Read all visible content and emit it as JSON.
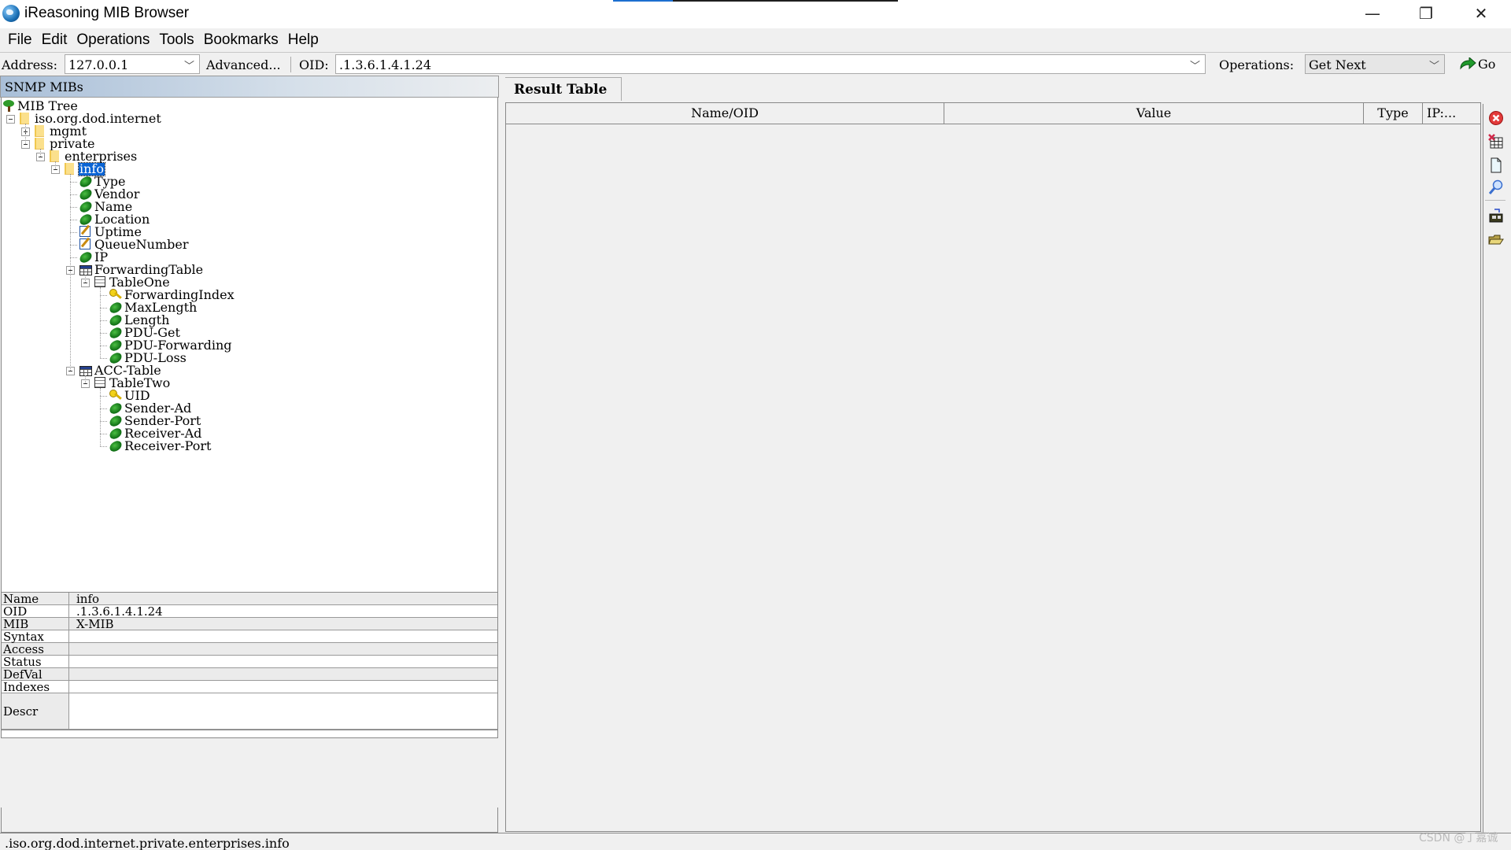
{
  "window": {
    "title": "iReasoning MIB Browser",
    "app_icon": "globe-icon",
    "controls": {
      "minimize": "—",
      "restore": "❐",
      "close": "✕"
    },
    "top_progress": 0.21
  },
  "menu": [
    "File",
    "Edit",
    "Operations",
    "Tools",
    "Bookmarks",
    "Help"
  ],
  "toolbar": {
    "address_label": "Address:",
    "address_value": "127.0.0.1",
    "advanced_label": "Advanced...",
    "oid_label": "OID:",
    "oid_value": ".1.3.6.1.4.1.24",
    "operations_label": "Operations:",
    "operations_value": "Get Next",
    "go_label": "Go",
    "chevron": "﹀"
  },
  "left_panel": {
    "header": "SNMP MIBs",
    "tree": [
      {
        "label": "MIB Tree",
        "icon": "tree-icon",
        "depth": 0,
        "expander": "none"
      },
      {
        "label": "iso.org.dod.internet",
        "icon": "folder-icon",
        "depth": 1,
        "expander": "minus"
      },
      {
        "label": "mgmt",
        "icon": "folder-icon",
        "depth": 2,
        "expander": "plus"
      },
      {
        "label": "private",
        "icon": "folder-icon",
        "depth": 2,
        "expander": "minus"
      },
      {
        "label": "enterprises",
        "icon": "folder-icon",
        "depth": 3,
        "expander": "minus"
      },
      {
        "label": "info",
        "icon": "folder-icon",
        "depth": 4,
        "expander": "minus",
        "selected": true
      },
      {
        "label": "Type",
        "icon": "leaf-icon",
        "depth": 5,
        "expander": "none"
      },
      {
        "label": "Vendor",
        "icon": "leaf-icon",
        "depth": 5,
        "expander": "none"
      },
      {
        "label": "Name",
        "icon": "leaf-icon",
        "depth": 5,
        "expander": "none"
      },
      {
        "label": "Location",
        "icon": "leaf-icon",
        "depth": 5,
        "expander": "none"
      },
      {
        "label": "Uptime",
        "icon": "writable-icon",
        "depth": 5,
        "expander": "none"
      },
      {
        "label": "QueueNumber",
        "icon": "writable-icon",
        "depth": 5,
        "expander": "none"
      },
      {
        "label": "IP",
        "icon": "leaf-icon",
        "depth": 5,
        "expander": "none"
      },
      {
        "label": "ForwardingTable",
        "icon": "table-icon",
        "depth": 5,
        "expander": "minus"
      },
      {
        "label": "TableOne",
        "icon": "table-entry-icon",
        "depth": 6,
        "expander": "minus"
      },
      {
        "label": "ForwardingIndex",
        "icon": "key-icon",
        "depth": 7,
        "expander": "none"
      },
      {
        "label": "MaxLength",
        "icon": "leaf-icon",
        "depth": 7,
        "expander": "none"
      },
      {
        "label": "Length",
        "icon": "leaf-icon",
        "depth": 7,
        "expander": "none"
      },
      {
        "label": "PDU-Get",
        "icon": "leaf-icon",
        "depth": 7,
        "expander": "none"
      },
      {
        "label": "PDU-Forwarding",
        "icon": "leaf-icon",
        "depth": 7,
        "expander": "none"
      },
      {
        "label": "PDU-Loss",
        "icon": "leaf-icon",
        "depth": 7,
        "expander": "none"
      },
      {
        "label": "ACC-Table",
        "icon": "table-icon",
        "depth": 5,
        "expander": "minus"
      },
      {
        "label": "TableTwo",
        "icon": "table-entry-icon",
        "depth": 6,
        "expander": "minus"
      },
      {
        "label": "UID",
        "icon": "key-icon",
        "depth": 7,
        "expander": "none"
      },
      {
        "label": "Sender-Ad",
        "icon": "leaf-icon",
        "depth": 7,
        "expander": "none"
      },
      {
        "label": "Sender-Port",
        "icon": "leaf-icon",
        "depth": 7,
        "expander": "none"
      },
      {
        "label": "Receiver-Ad",
        "icon": "leaf-icon",
        "depth": 7,
        "expander": "none"
      },
      {
        "label": "Receiver-Port",
        "icon": "leaf-icon",
        "depth": 7,
        "expander": "none"
      }
    ],
    "properties": [
      {
        "key": "Name",
        "value": "info"
      },
      {
        "key": "OID",
        "value": ".1.3.6.1.4.1.24"
      },
      {
        "key": "MIB",
        "value": "X-MIB"
      },
      {
        "key": "Syntax",
        "value": ""
      },
      {
        "key": "Access",
        "value": ""
      },
      {
        "key": "Status",
        "value": ""
      },
      {
        "key": "DefVal",
        "value": ""
      },
      {
        "key": "Indexes",
        "value": ""
      },
      {
        "key": "Descr",
        "value": ""
      }
    ]
  },
  "right_panel": {
    "tab": "Result Table",
    "columns": [
      "Name/OID",
      "Value",
      "Type",
      "IP:..."
    ],
    "rows": [],
    "side_tools": [
      {
        "name": "stop-icon"
      },
      {
        "name": "clear-table-icon"
      },
      {
        "name": "document-icon"
      },
      {
        "name": "find-icon"
      },
      {
        "name": "save-icon"
      },
      {
        "name": "open-folder-icon"
      }
    ]
  },
  "status_bar": {
    "path": ".iso.org.dod.internet.private.enterprises.info"
  },
  "watermark": "CSDN @丁嘉诚",
  "colors": {
    "selection": "#0a64d4",
    "header_gradient_start": "#a9bfd8",
    "leaf_green": "#1e8a1e"
  }
}
